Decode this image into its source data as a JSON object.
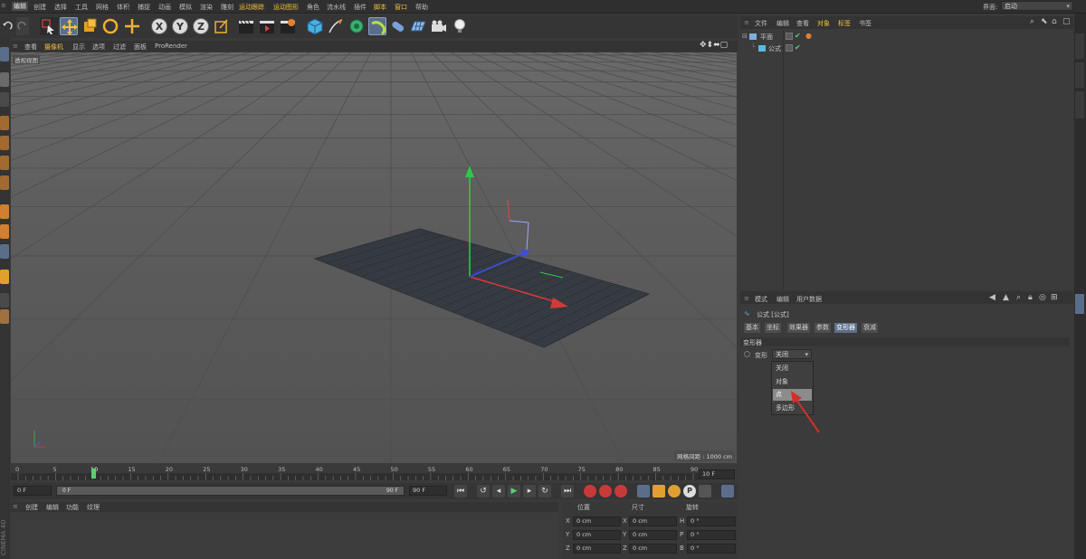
{
  "menubar": {
    "items": [
      "编辑",
      "创建",
      "选择",
      "工具",
      "网格",
      "体积",
      "捕捉",
      "动画",
      "模拟",
      "渲染",
      "雕刻",
      "运动跟踪",
      "运动图形",
      "角色",
      "流水线",
      "插件",
      "脚本",
      "窗口",
      "帮助"
    ],
    "layout_label": "界面:",
    "layout_value": "启动"
  },
  "toolbar": {
    "axis_x": "X",
    "axis_y": "Y",
    "axis_z": "Z"
  },
  "viewport": {
    "menu": [
      "查看",
      "摄像机",
      "显示",
      "选项",
      "过滤",
      "面板",
      "ProRender"
    ],
    "label": "透视视图",
    "grid_distance": "网格间距 : 1000 cm"
  },
  "timeline": {
    "ticks": [
      "0",
      "5",
      "10",
      "15",
      "20",
      "25",
      "30",
      "35",
      "40",
      "45",
      "50",
      "55",
      "60",
      "65",
      "70",
      "75",
      "80",
      "85",
      "90"
    ],
    "current_frame": "10",
    "end_field": "10 F",
    "start_field": "0 F",
    "range_start": "0 F",
    "range_end": "90 F",
    "max_field": "90 F"
  },
  "material": {
    "menu": [
      "创建",
      "编辑",
      "功能",
      "纹理"
    ]
  },
  "coords": {
    "headers": [
      "位置",
      "尺寸",
      "旋转"
    ],
    "rows": [
      {
        "axis": "X",
        "pos": "0 cm",
        "size_axis": "X",
        "size": "0 cm",
        "rot_axis": "H",
        "rot": "0 °"
      },
      {
        "axis": "Y",
        "pos": "0 cm",
        "size_axis": "Y",
        "size": "0 cm",
        "rot_axis": "P",
        "rot": "0 °"
      },
      {
        "axis": "Z",
        "pos": "0 cm",
        "size_axis": "Z",
        "size": "0 cm",
        "rot_axis": "B",
        "rot": "0 °"
      }
    ]
  },
  "object_manager": {
    "menu": [
      "文件",
      "编辑",
      "查看",
      "对象",
      "标签",
      "书签"
    ],
    "objects": [
      {
        "name": "平面",
        "color": "#e6c44a"
      },
      {
        "name": "公式",
        "color": "#e6c44a"
      }
    ]
  },
  "attribute_manager": {
    "menu": [
      "模式",
      "编辑",
      "用户数据"
    ],
    "object_title": "公式 [公式]",
    "tabs": [
      "基本",
      "坐标",
      "效果器",
      "参数",
      "变形器",
      "衰减"
    ],
    "active_tab": "变形器",
    "section": "变形器",
    "field_label": "变形",
    "field_value": "关闭",
    "options": [
      "关闭",
      "对象",
      "点",
      "多边形"
    ],
    "selected_option": "点"
  },
  "branding": {
    "side_text": "CINEMA 4D"
  },
  "colors": {
    "accent_blue": "#5d6f8a",
    "axis_red": "#d23a3a",
    "axis_green": "#2ec84a",
    "axis_blue": "#3a4fe0",
    "arrow_red": "#d0302a"
  }
}
